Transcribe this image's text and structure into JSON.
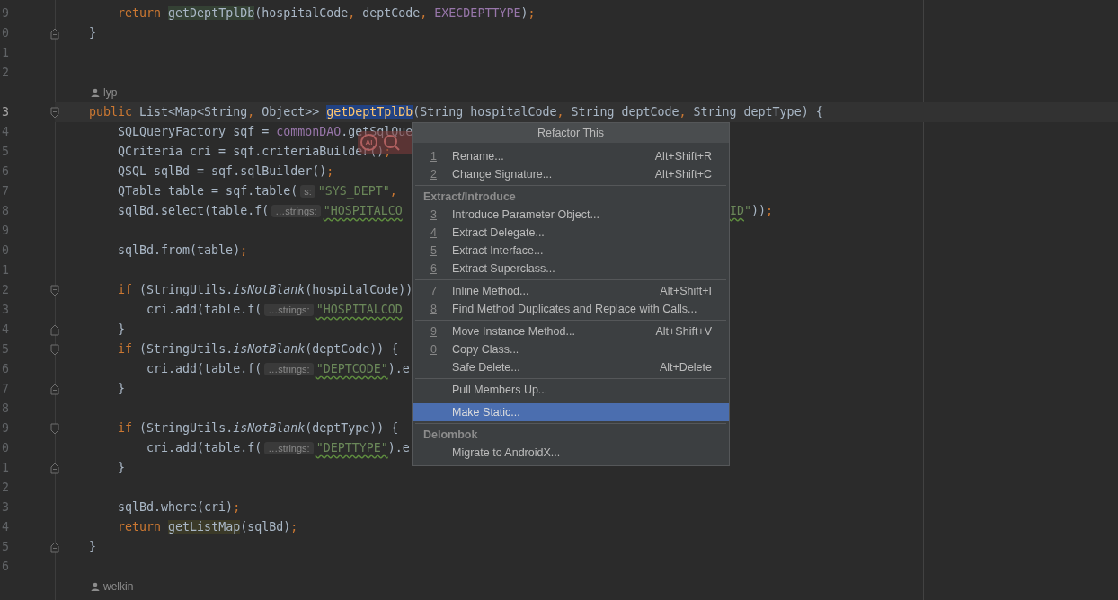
{
  "editor": {
    "lines": [
      {
        "kind": "code",
        "number": "9",
        "current": false,
        "tokens": [
          {
            "kind": "kw",
            "text": "        return "
          },
          {
            "kind": "hlg",
            "text": "getDeptTplDb"
          },
          {
            "kind": "plain",
            "text": "(hospitalCode"
          },
          {
            "kind": "punct",
            "text": ","
          },
          {
            "kind": "plain",
            "text": " deptCode"
          },
          {
            "kind": "punct",
            "text": ", "
          },
          {
            "kind": "const",
            "text": "EXECDEPTTYPE"
          },
          {
            "kind": "plain",
            "text": ")"
          },
          {
            "kind": "punct",
            "text": ";"
          }
        ]
      },
      {
        "kind": "code",
        "number": "0",
        "fold_end": true,
        "current": false,
        "tokens": [
          {
            "kind": "plain",
            "text": "    }"
          }
        ]
      },
      {
        "kind": "code",
        "number": "1",
        "current": false
      },
      {
        "kind": "code",
        "number": "2",
        "current": false
      },
      {
        "kind": "author",
        "name": "lyp"
      },
      {
        "kind": "code",
        "number": "3",
        "fold_start": true,
        "current": true,
        "tokens": [
          {
            "kind": "kw",
            "text": "    public"
          },
          {
            "kind": "plain",
            "text": " List<Map<String"
          },
          {
            "kind": "punct",
            "text": ","
          },
          {
            "kind": "plain",
            "text": " Object>> "
          },
          {
            "kind": "sel",
            "text": "getDeptTplDb"
          },
          {
            "kind": "plain",
            "text": "(String hospitalCode"
          },
          {
            "kind": "punct",
            "text": ","
          },
          {
            "kind": "plain",
            "text": " String deptCode"
          },
          {
            "kind": "punct",
            "text": ","
          },
          {
            "kind": "plain",
            "text": " String deptType) {"
          }
        ]
      },
      {
        "kind": "code",
        "number": "4",
        "current": false,
        "tokens": [
          {
            "kind": "plain",
            "text": "        SQLQueryFactory sqf = "
          },
          {
            "kind": "const",
            "text": "commonDAO"
          },
          {
            "kind": "plain",
            "text": ".getSqlQue"
          }
        ]
      },
      {
        "kind": "code",
        "number": "5",
        "current": false,
        "tokens": [
          {
            "kind": "plain",
            "text": "        QCriteria cri = sqf.criteriaBuilder()"
          },
          {
            "kind": "punct",
            "text": ";"
          }
        ]
      },
      {
        "kind": "code",
        "number": "6",
        "current": false,
        "tokens": [
          {
            "kind": "plain",
            "text": "        QSQL sqlBd = sqf.sqlBuilder()"
          },
          {
            "kind": "punct",
            "text": ";"
          }
        ]
      },
      {
        "kind": "code",
        "number": "7",
        "current": false,
        "tokens": [
          {
            "kind": "plain",
            "text": "        QTable table = sqf.table("
          },
          {
            "kind": "hint",
            "text": "s:"
          },
          {
            "kind": "str",
            "text": "\"SYS_DEPT\""
          },
          {
            "kind": "punct",
            "text": ","
          }
        ]
      },
      {
        "kind": "code",
        "number": "8",
        "current": false,
        "tokens": [
          {
            "kind": "plain",
            "text": "        sqlBd.select(table.f("
          },
          {
            "kind": "hint",
            "text": "…strings:"
          },
          {
            "kind": "typo",
            "text": "\"HOSPITALCO"
          }
        ],
        "tail": [
          {
            "kind": "typo",
            "text": "ID"
          },
          {
            "kind": "str",
            "text": "\""
          },
          {
            "kind": "plain",
            "text": "))"
          },
          {
            "kind": "punct",
            "text": ";"
          }
        ]
      },
      {
        "kind": "code",
        "number": "9",
        "current": false
      },
      {
        "kind": "code",
        "number": "0",
        "current": false,
        "tokens": [
          {
            "kind": "plain",
            "text": "        sqlBd.from(table)"
          },
          {
            "kind": "punct",
            "text": ";"
          }
        ]
      },
      {
        "kind": "code",
        "number": "1",
        "current": false
      },
      {
        "kind": "code",
        "number": "2",
        "fold_start": true,
        "current": false,
        "tokens": [
          {
            "kind": "kw",
            "text": "        if"
          },
          {
            "kind": "plain",
            "text": " (StringUtils."
          },
          {
            "kind": "italic",
            "text": "isNotBlank"
          },
          {
            "kind": "plain",
            "text": "(hospitalCode))"
          }
        ]
      },
      {
        "kind": "code",
        "number": "3",
        "current": false,
        "tokens": [
          {
            "kind": "plain",
            "text": "            cri.add(table.f("
          },
          {
            "kind": "hint",
            "text": "…strings:"
          },
          {
            "kind": "typo",
            "text": "\"HOSPITALCOD"
          }
        ]
      },
      {
        "kind": "code",
        "number": "4",
        "fold_end": true,
        "current": false,
        "tokens": [
          {
            "kind": "plain",
            "text": "        }"
          }
        ]
      },
      {
        "kind": "code",
        "number": "5",
        "fold_start": true,
        "current": false,
        "tokens": [
          {
            "kind": "kw",
            "text": "        if"
          },
          {
            "kind": "plain",
            "text": " (StringUtils."
          },
          {
            "kind": "italic",
            "text": "isNotBlank"
          },
          {
            "kind": "plain",
            "text": "(deptCode)) {"
          }
        ]
      },
      {
        "kind": "code",
        "number": "6",
        "current": false,
        "tokens": [
          {
            "kind": "plain",
            "text": "            cri.add(table.f("
          },
          {
            "kind": "hint",
            "text": "…strings:"
          },
          {
            "kind": "typo",
            "text": "\"DEPTCODE\""
          },
          {
            "kind": "plain",
            "text": ").e"
          }
        ]
      },
      {
        "kind": "code",
        "number": "7",
        "fold_end": true,
        "current": false,
        "tokens": [
          {
            "kind": "plain",
            "text": "        }"
          }
        ]
      },
      {
        "kind": "code",
        "number": "8",
        "current": false
      },
      {
        "kind": "code",
        "number": "9",
        "fold_start": true,
        "current": false,
        "tokens": [
          {
            "kind": "kw",
            "text": "        if"
          },
          {
            "kind": "plain",
            "text": " (StringUtils."
          },
          {
            "kind": "italic",
            "text": "isNotBlank"
          },
          {
            "kind": "plain",
            "text": "(deptType)) {"
          }
        ]
      },
      {
        "kind": "code",
        "number": "0",
        "current": false,
        "tokens": [
          {
            "kind": "plain",
            "text": "            cri.add(table.f("
          },
          {
            "kind": "hint",
            "text": "…strings:"
          },
          {
            "kind": "typo",
            "text": "\"DEPTTYPE\""
          },
          {
            "kind": "plain",
            "text": ").e"
          }
        ]
      },
      {
        "kind": "code",
        "number": "1",
        "fold_end": true,
        "current": false,
        "tokens": [
          {
            "kind": "plain",
            "text": "        }"
          }
        ]
      },
      {
        "kind": "code",
        "number": "2",
        "current": false
      },
      {
        "kind": "code",
        "number": "3",
        "current": false,
        "tokens": [
          {
            "kind": "plain",
            "text": "        sqlBd.where(cri)"
          },
          {
            "kind": "punct",
            "text": ";"
          }
        ]
      },
      {
        "kind": "code",
        "number": "4",
        "current": false,
        "tokens": [
          {
            "kind": "kw",
            "text": "        return "
          },
          {
            "kind": "hly",
            "text": "getListMap"
          },
          {
            "kind": "plain",
            "text": "(sqlBd)"
          },
          {
            "kind": "punct",
            "text": ";"
          }
        ]
      },
      {
        "kind": "code",
        "number": "5",
        "fold_end": true,
        "current": false,
        "tokens": [
          {
            "kind": "plain",
            "text": "    }"
          }
        ]
      },
      {
        "kind": "code",
        "number": "6",
        "current": false
      },
      {
        "kind": "author",
        "name": "welkin"
      }
    ]
  },
  "floating_toolbar": {
    "label": "AI"
  },
  "popup": {
    "title": "Refactor This",
    "items": [
      {
        "kind": "item",
        "mnemonic": "1",
        "label": "Rename...",
        "shortcut": "Alt+Shift+R",
        "selected": false
      },
      {
        "kind": "item",
        "mnemonic": "2",
        "label": "Change Signature...",
        "shortcut": "Alt+Shift+C",
        "selected": false
      },
      {
        "kind": "separator"
      },
      {
        "kind": "group",
        "label": "Extract/Introduce"
      },
      {
        "kind": "item",
        "mnemonic": "3",
        "label": "Introduce Parameter Object...",
        "selected": false
      },
      {
        "kind": "item",
        "mnemonic": "4",
        "label": "Extract Delegate...",
        "selected": false
      },
      {
        "kind": "item",
        "mnemonic": "5",
        "label": "Extract Interface...",
        "selected": false
      },
      {
        "kind": "item",
        "mnemonic": "6",
        "label": "Extract Superclass...",
        "selected": false
      },
      {
        "kind": "separator"
      },
      {
        "kind": "item",
        "mnemonic": "7",
        "label": "Inline Method...",
        "shortcut": "Alt+Shift+I",
        "selected": false
      },
      {
        "kind": "item",
        "mnemonic": "8",
        "label": "Find Method Duplicates and Replace with Calls...",
        "selected": false
      },
      {
        "kind": "separator"
      },
      {
        "kind": "item",
        "mnemonic": "9",
        "label": "Move Instance Method...",
        "shortcut": "Alt+Shift+V",
        "selected": false
      },
      {
        "kind": "item",
        "mnemonic": "0",
        "label": "Copy Class...",
        "selected": false
      },
      {
        "kind": "item",
        "label": "Safe Delete...",
        "shortcut": "Alt+Delete",
        "selected": false
      },
      {
        "kind": "separator"
      },
      {
        "kind": "item",
        "label": "Pull Members Up...",
        "selected": false
      },
      {
        "kind": "separator"
      },
      {
        "kind": "item",
        "label": "Make Static...",
        "selected": true
      },
      {
        "kind": "separator"
      },
      {
        "kind": "group",
        "label": "Delombok"
      },
      {
        "kind": "item",
        "label": "Migrate to AndroidX...",
        "selected": false
      }
    ]
  }
}
